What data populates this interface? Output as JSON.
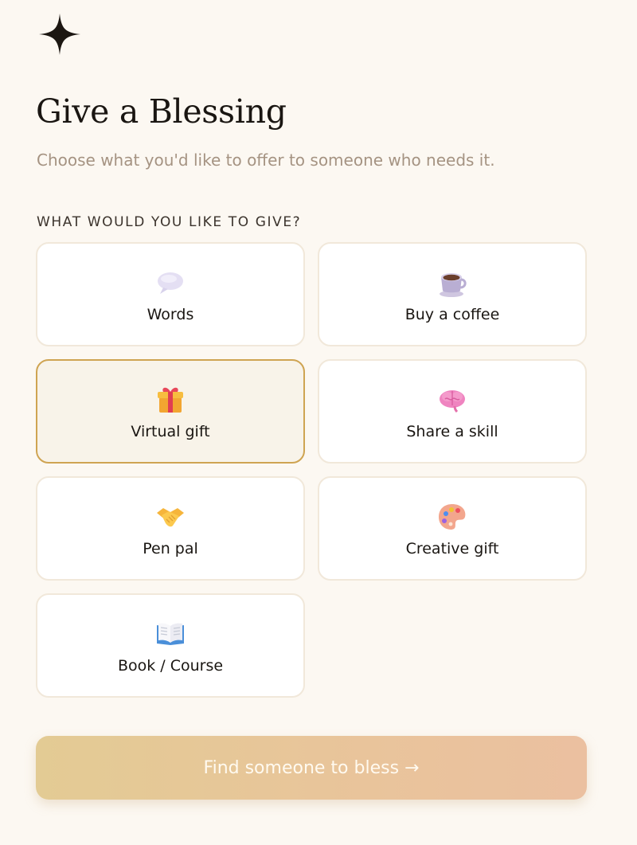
{
  "header": {
    "logo_icon": "four-point-sparkle-icon",
    "title": "Give a Blessing",
    "subtitle": "Choose what you'd like to offer to someone who needs it."
  },
  "form": {
    "section_label": "WHAT WOULD YOU LIKE TO GIVE?",
    "selected": "Virtual gift",
    "options": [
      {
        "label": "Words",
        "icon": "speech-bubble-icon",
        "selected": false
      },
      {
        "label": "Buy a coffee",
        "icon": "coffee-cup-icon",
        "selected": false
      },
      {
        "label": "Virtual gift",
        "icon": "gift-icon",
        "selected": true
      },
      {
        "label": "Share a skill",
        "icon": "brain-icon",
        "selected": false
      },
      {
        "label": "Pen pal",
        "icon": "handshake-icon",
        "selected": false
      },
      {
        "label": "Creative gift",
        "icon": "artist-palette-icon",
        "selected": false
      },
      {
        "label": "Book / Course",
        "icon": "open-book-icon",
        "selected": false
      }
    ]
  },
  "cta": {
    "label": "Find someone to bless →"
  },
  "colors": {
    "background": "#fcf8f2",
    "card_border": "#f1e8da",
    "selected_border": "#cfa452",
    "selected_background": "#f8f3e9",
    "subtitle": "#a59382",
    "cta_gradient_start": "#e3cb94",
    "cta_gradient_end": "#ebc0a0"
  }
}
